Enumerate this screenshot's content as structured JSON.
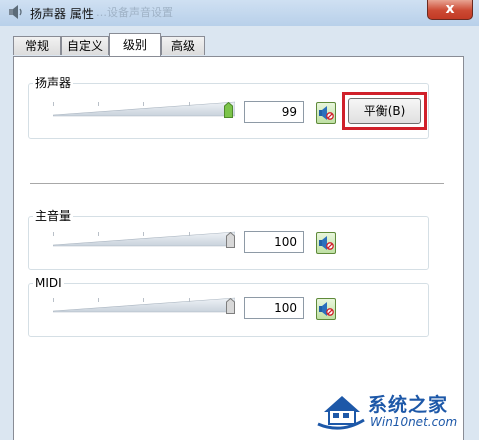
{
  "window": {
    "title": "扬声器 属性",
    "faded_title_text": "…设备声音设置",
    "close_glyph": "x"
  },
  "tabs": [
    {
      "label": "常规",
      "active": false
    },
    {
      "label": "自定义",
      "active": false
    },
    {
      "label": "级别",
      "active": true
    },
    {
      "label": "高级",
      "active": false
    }
  ],
  "levels": {
    "speaker": {
      "label": "扬声器",
      "value": "99",
      "level": 0.99,
      "thumb_color": "#7cc44a"
    },
    "master": {
      "label": "主音量",
      "value": "100",
      "level": 1.0,
      "thumb_color": "#d8d8d8"
    },
    "midi": {
      "label": "MIDI",
      "value": "100",
      "level": 1.0,
      "thumb_color": "#d8d8d8"
    }
  },
  "balance_button": {
    "label": "平衡(B)",
    "highlight_color": "#d0202a"
  },
  "watermark": {
    "name": "系统之家",
    "url": "Win10net.com",
    "brand_color": "#1d58a8"
  },
  "icons": {
    "window": "speaker-icon",
    "mute": "speaker-mute-icon",
    "watermark": "house-logo-icon"
  }
}
